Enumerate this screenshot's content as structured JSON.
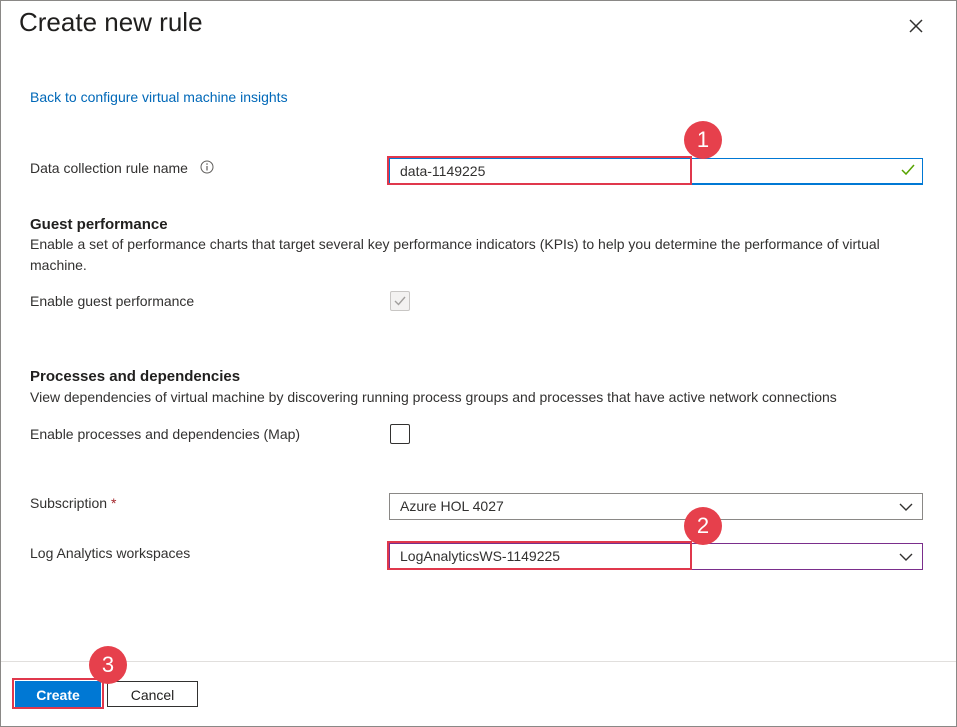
{
  "dialog": {
    "title": "Create new rule",
    "back_link": "Back to configure virtual machine insights"
  },
  "form": {
    "rule_name_label": "Data collection rule name",
    "rule_name_value": "data-1149225",
    "guest_heading": "Guest performance",
    "guest_desc": "Enable a set of performance charts that target several key performance indicators (KPIs) to help you determine the performance of virtual machine.",
    "guest_enable_label": "Enable guest performance",
    "guest_enabled": true,
    "proc_heading": "Processes and dependencies",
    "proc_desc": "View dependencies of virtual machine by discovering running process groups and processes that have active network connections",
    "proc_enable_label": "Enable processes and dependencies (Map)",
    "proc_enabled": false,
    "subscription_label": "Subscription",
    "subscription_required": "*",
    "subscription_value": "Azure HOL 4027",
    "workspace_label": "Log Analytics workspaces",
    "workspace_value": "LogAnalyticsWS-1149225"
  },
  "footer": {
    "create_label": "Create",
    "cancel_label": "Cancel"
  },
  "callouts": [
    "1",
    "2",
    "3"
  ],
  "colors": {
    "accent": "#0078d4",
    "callout": "#e6404c",
    "link": "#0068b8"
  }
}
